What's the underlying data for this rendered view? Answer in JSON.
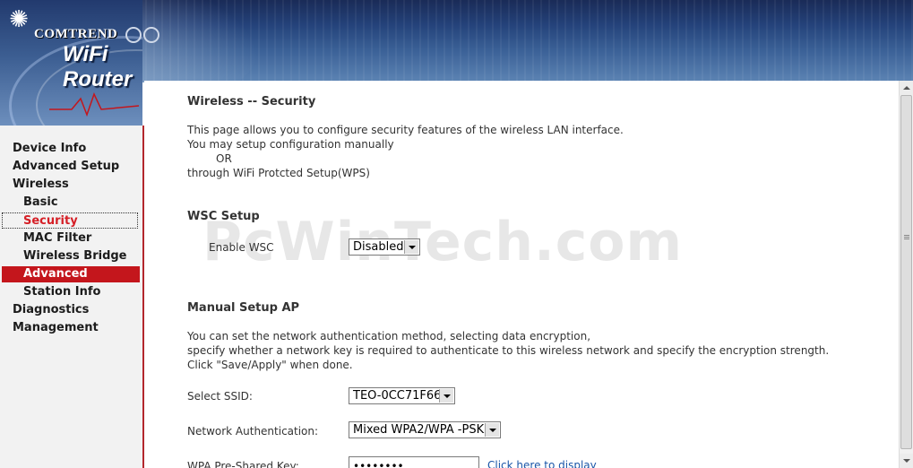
{
  "header": {
    "brand": "COMTREND",
    "product": "WiFi Router"
  },
  "sidebar": {
    "items": [
      {
        "label": "Device Info"
      },
      {
        "label": "Advanced Setup"
      },
      {
        "label": "Wireless"
      },
      {
        "label": "Basic"
      },
      {
        "label": "Security"
      },
      {
        "label": "MAC Filter"
      },
      {
        "label": "Wireless Bridge"
      },
      {
        "label": "Advanced"
      },
      {
        "label": "Station Info"
      },
      {
        "label": "Diagnostics"
      },
      {
        "label": "Management"
      }
    ]
  },
  "main": {
    "title": "Wireless -- Security",
    "intro_line1": "This page allows you to configure security features of the wireless LAN interface.",
    "intro_line2": "You may setup configuration manually",
    "intro_or": "OR",
    "intro_line3": "through WiFi Protcted Setup(WPS)",
    "wsc_heading": "WSC Setup",
    "wsc_label": "Enable WSC",
    "wsc_value": "Disabled",
    "manual_heading": "Manual Setup AP",
    "manual_line1": "You can set the network authentication method, selecting data encryption,",
    "manual_line2": "specify whether a network key is required to authenticate to this wireless network and specify the encryption strength.",
    "manual_line3": "Click \"Save/Apply\" when done.",
    "ssid_label": "Select SSID:",
    "ssid_value": "TEO-0CC71F66",
    "auth_label": "Network Authentication:",
    "auth_value": "Mixed WPA2/WPA -PSK",
    "psk_label": "WPA Pre-Shared Key:",
    "psk_value": "••••••••",
    "psk_link": "Click here to display"
  },
  "watermark": "PcWinTech.com",
  "colors": {
    "accent_red": "#c4161c",
    "banner_blue": "#24427a"
  }
}
